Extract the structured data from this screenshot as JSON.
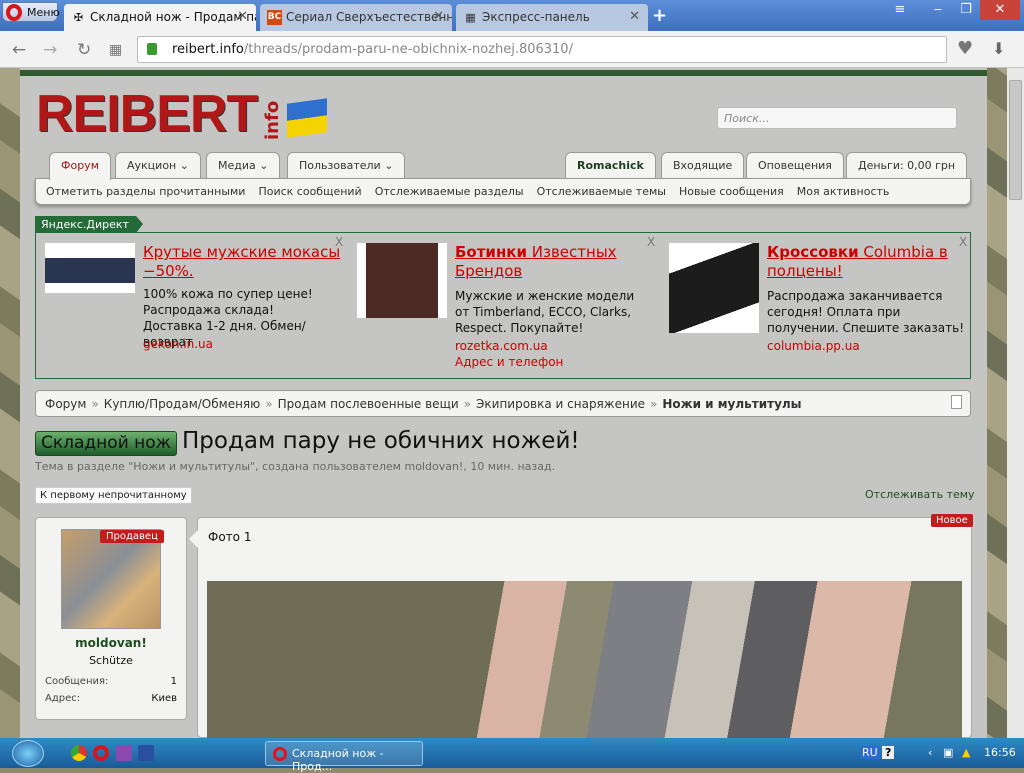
{
  "browser": {
    "menu_label": "Меню",
    "tabs": [
      {
        "title": "Складной нож - Продам пар",
        "icon": "iron-cross-icon"
      },
      {
        "title": "Сериал Сверхъестественн",
        "icon": "bc-icon"
      },
      {
        "title": "Экспресс-панель",
        "icon": "grid-icon"
      }
    ],
    "url_domain": "reibert.info",
    "url_path": "/threads/prodam-paru-ne-obichnix-nozhej.806310/"
  },
  "site": {
    "logo": "REIBERT",
    "logo_suffix": "info",
    "search_placeholder": "Поиск...",
    "nav_tabs": [
      "Форум",
      "Аукцион",
      "Медиа",
      "Пользователи"
    ],
    "user_tabs": [
      "Romachick",
      "Входящие",
      "Оповещения",
      "Деньги: 0,00 грн"
    ],
    "subnav": [
      "Отметить разделы прочитанными",
      "Поиск сообщений",
      "Отслеживаемые разделы",
      "Отслеживаемые темы",
      "Новые сообщения",
      "Моя активность"
    ]
  },
  "ads": {
    "label": "Яндекс.Директ",
    "items": [
      {
        "title_bold": "",
        "title": "Крутые мужские мокасы −50%.",
        "desc": "100% кожа по супер цене! Распродажа склада! Доставка 1-2 дня. Обмен/возврат",
        "url": "gekon.in.ua",
        "extra": ""
      },
      {
        "title_bold": "Ботинки",
        "title": " Известных Брендов",
        "desc": "Мужские и женские модели от Timberland, ECCO, Clarks, Respect. Покупайте!",
        "url": "rozetka.com.ua",
        "extra": "Адрес и телефон"
      },
      {
        "title_bold": "Кроссовки",
        "title": " Columbia в полцены!",
        "desc": "Распродажа заканчивается сегодня! Оплата при получении. Спешите заказать!",
        "url": "columbia.pp.ua",
        "extra": ""
      }
    ],
    "close": "X"
  },
  "breadcrumb": [
    "Форум",
    "Куплю/Продам/Обменяю",
    "Продам послевоенные вещи",
    "Экипировка и снаряжение",
    "Ножи и мультитулы"
  ],
  "breadcrumb_sep": "»",
  "thread": {
    "prefix": "Складной нож",
    "title": "Продам пару не обичних ножей!",
    "subtitle": "Тема в разделе \"Ножи и мультитулы\", создана пользователем moldovan!, 10 мин. назад.",
    "first_unread": "К первому непрочитанному",
    "track": "Отслеживать тему"
  },
  "post": {
    "author": "moldovan!",
    "rank": "Schütze",
    "seller_badge": "Продавец",
    "stats": [
      {
        "label": "Сообщения:",
        "value": "1"
      },
      {
        "label": "Адрес:",
        "value": "Киев"
      }
    ],
    "new_badge": "Новое",
    "text": "Фото 1"
  },
  "taskbar": {
    "task": "Складной нож - Прод...",
    "lang": "RU",
    "time": "16:56"
  }
}
